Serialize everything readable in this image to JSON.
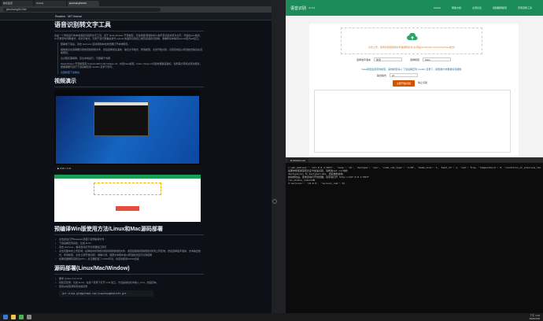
{
  "left_browser": {
    "tabs": [
      {
        "label": "新标签页"
      },
      {
        "label": "GitHub"
      },
      {
        "label": "jianchang512/stt"
      }
    ],
    "address": "jianchang512/stt",
    "site_nav": [
      "Readme",
      "MIT license"
    ],
    "title": "语音识别转文字工具",
    "intro": "这是一个离线运行的本地语音识别转文字工具，基于 fasterwhipser 开源模型，可将视频/音频中的人类声音识别并转为文字，可输出json格式、srt字幕带时间戳格式、纯文字格式。可用于自行部署后替代 openai 的语音识别接口或百度语音识别等，准确率基本等同openai官方api接口。",
    "bullets": [
      "部署或下载后，双击 start.exe 自动调用本地浏览器打开本地网页。",
      "拖拽或点击选择要识别的音频视频文件，然后选择发生语言、输出文字格式、所用模型，点击开始识别，识别完成后以所选格式输出在当前网页。",
      "全过程无需联网，完全本地运行，可部署于内网",
      "fasterwhisper 开源模型有 base/small/medium/large-v3，内置base模型，base->large-v3识别效果越来越好，但所需计算机资源也更多，根据需要可自行下载后解压到 models 目录下即可。"
    ],
    "models_link": "全部模型下载地址",
    "video_heading": "视频演示",
    "video_time": "0:00 / 1:31",
    "deploy_heading": "预编译Win版使用方法/Linux和Mac源码部署",
    "deploy_items": [
      "点击此处打开Releases页面下载预编译文件",
      "下载后解压到某处，比如 E:/stt",
      "双击 start.exe，等待自动打开浏览器窗口即可",
      "点击页面中的上传区域，在弹窗中找到想识别的音频或视频文件，或直接拖拽音频视频文件到上传区域，然后选择发声语言、文本输出格式、所用模型，点击'立即开始识别'，稍等片刻，底部文本框中会以所选格式显示识别结果",
      "如果机器拥有英伟达GPU，并正确配置了CUDA环境，将自动使用CUDA加速"
    ],
    "source_heading": "源码部署(Linux/Mac/Window)",
    "source_items": [
      "要求 python 3.9->3.11",
      "创建空目录，比如 E:/stt，在这个目录下打开 cmd 窗口，方法是地址栏中输入 cmd，然后回车。",
      "使用git拉取源码到当前目录"
    ],
    "source_code": "git clone git@github.com:jianchang512/stt.git ."
  },
  "right_browser": {
    "brand": "语音识别",
    "version": "v0.0.9",
    "nav": [
      "Github",
      "帮助文档",
      "交流论坛",
      "视频翻译配音",
      "声音克隆工具"
    ],
    "dropzone_text": "点击上传，或者将音频视频文件拖拽到此处(必须是mp4/mp3/mov/mkv/avi/wav格式)",
    "lang_label": "选择发声语言",
    "lang_value": "中文",
    "model_label": "选择模型",
    "model_value": "base",
    "format_label": "输出格式",
    "format_value": "srt",
    "hint": "base模型会自带的模型，其他模型请从 下载后解压到 models 目录下，模型越大效果越好但越慢",
    "start_button": "立即开始识别",
    "stop_button": "停止识别"
  },
  "terminal": {
    "tab": "E:\\stt\\start.exe",
    "lines": [
      "{'web_address': '127.0.0.1:9977', 'lang': 'zh', 'devtype': 'cpu', 'cuda_com_type': 'int8', 'beam_size': 1, 'best_of': 1, 'vad': True, 'temperature': 0, 'condition_on_previous_text': False, 'initial_prompt_zh': '以下是普通话的句子。'}",
      "",
      "如果你想使用英伟达显卡加速识别，请修改set.ini中的",
      "devtype=cpu 为 devtype=cuda, 然后重新启动",
      "",
      "启动成功后，若未自动打开浏览器，请手动打开 http://127.0.0.1:9977",
      "run_status_code=100",
      "d'versionc': 'v0.0.9', 'version_num': 9}"
    ]
  },
  "taskbar": {
    "time": "下午 4:16",
    "date": "2024/3/18"
  }
}
